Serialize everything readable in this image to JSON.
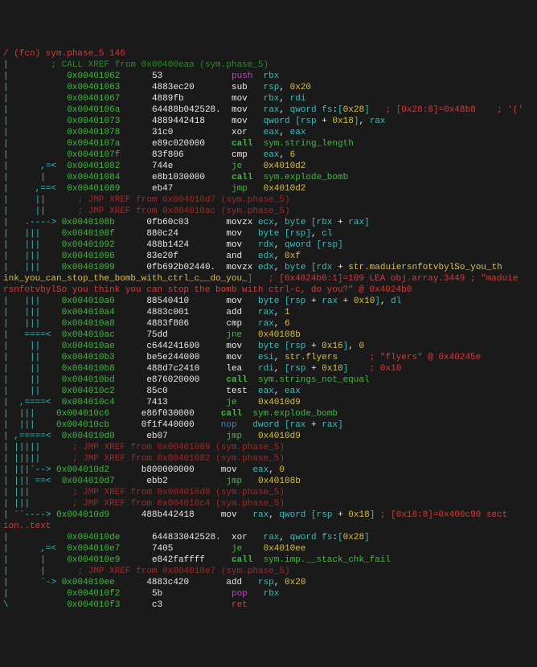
{
  "header": {
    "fcn": "/ (fcn) sym.phase_5 146",
    "xref": "        ; CALL XREF from 0x00400eaa (sym.phase_5)"
  },
  "rows": [
    {
      "p": "|           ",
      "a": "0x00401062",
      "b": "53            ",
      "o": "push",
      "r": "rbx"
    },
    {
      "p": "|           ",
      "a": "0x00401063",
      "b": "4883ec20      ",
      "o": "sub",
      "r": "rsp, 0x20"
    },
    {
      "p": "|           ",
      "a": "0x00401067",
      "b": "4889fb        ",
      "o": "mov",
      "r": "rbx, rdi"
    },
    {
      "p": "|           ",
      "a": "0x0040106a",
      "b": "64488b042528. ",
      "o": "mov",
      "r": "rax, qword fs:[0x28]",
      "c": "   ; [0x28:8]=0x48b8    ; '('"
    },
    {
      "p": "|           ",
      "a": "0x00401073",
      "b": "4889442418    ",
      "o": "mov",
      "r": "qword [rsp + 0x18], rax"
    },
    {
      "p": "|           ",
      "a": "0x00401078",
      "b": "31c0          ",
      "o": "xor",
      "r": "eax, eax"
    },
    {
      "p": "|           ",
      "a": "0x0040107a",
      "b": "e89c020000    ",
      "o": "call",
      "r": "sym.string_length",
      "call": true
    },
    {
      "p": "|           ",
      "a": "0x0040107f",
      "b": "83f806        ",
      "o": "cmp",
      "r": "eax, 6"
    },
    {
      "p": "|      ,=<  ",
      "a": "0x00401082",
      "b": "744e          ",
      "o": "je",
      "r": "0x4010d2"
    },
    {
      "p": "|      |    ",
      "a": "0x00401084",
      "b": "e8b1030000    ",
      "o": "call",
      "r": "sym.explode_bomb",
      "call": true
    },
    {
      "p": "|     ,==<  ",
      "a": "0x00401089",
      "b": "eb47          ",
      "o": "jmp",
      "r": "0x4010d2"
    },
    {
      "p": "|     ||    ",
      "x": "  ; JMP XREF from 0x004010d7 (sym.phase_5)"
    },
    {
      "p": "|     ||    ",
      "x": "  ; JMP XREF from 0x004010ac (sym.phase_5)"
    },
    {
      "p": "|   .----> ",
      "a": "0x0040108b",
      "b": "0fb60c03      ",
      "o": "movzx",
      "r": "ecx, byte [rbx + rax]"
    },
    {
      "p": "|   |||    ",
      "a": "0x0040108f",
      "b": "880c24        ",
      "o": "mov",
      "r": "byte [rsp], cl"
    },
    {
      "p": "|   |||    ",
      "a": "0x00401092",
      "b": "488b1424      ",
      "o": "mov",
      "r": "rdx, qword [rsp]"
    },
    {
      "p": "|   |||    ",
      "a": "0x00401096",
      "b": "83e20f        ",
      "o": "and",
      "r": "edx, 0xf"
    },
    {
      "p": "|   |||    ",
      "a": "0x00401099",
      "b": "0fb692b02440. ",
      "o": "movzx",
      "r": "edx, byte [rdx + str.maduiersnfotvbylSo_you_th",
      "nowrap": true
    },
    {
      "raw": true,
      "p": "",
      "text": "ink_you_can_stop_the_bomb_with_ctrl_c__do_you_",
      "comment": "]   ; [0x4024b0:1]=109 LEA obj.array.3449 ; \"maduie"
    },
    {
      "raw": true,
      "p": "",
      "text2": "rsnfotvbylSo you think you can stop the bomb with ctrl-c, do you?\" @ 0x4024b0"
    },
    {
      "p": "|   |||    ",
      "a": "0x004010a0",
      "b": "88540410      ",
      "o": "mov",
      "r": "byte [rsp + rax + 0x10], dl"
    },
    {
      "p": "|   |||    ",
      "a": "0x004010a4",
      "b": "4883c001      ",
      "o": "add",
      "r": "rax, 1"
    },
    {
      "p": "|   |||    ",
      "a": "0x004010a8",
      "b": "4883f806      ",
      "o": "cmp",
      "r": "rax, 6"
    },
    {
      "p": "|   ====<  ",
      "a": "0x004010ac",
      "b": "75dd          ",
      "o": "jne",
      "r": "0x40108b"
    },
    {
      "p": "|    ||    ",
      "a": "0x004010ae",
      "b": "c644241600    ",
      "o": "mov",
      "r": "byte [rsp + 0x16], 0"
    },
    {
      "p": "|    ||    ",
      "a": "0x004010b3",
      "b": "be5e244000    ",
      "o": "mov",
      "r": "esi, str.flyers",
      "c": "      ; \"flyers\" @ 0x40245e"
    },
    {
      "p": "|    ||    ",
      "a": "0x004010b8",
      "b": "488d7c2410    ",
      "o": "lea",
      "r": "rdi, [rsp + 0x10]",
      "c": "    ; 0x10"
    },
    {
      "p": "|    ||    ",
      "a": "0x004010bd",
      "b": "e876020000    ",
      "o": "call",
      "r": "sym.strings_not_equal",
      "call": true
    },
    {
      "p": "|    ||    ",
      "a": "0x004010c2",
      "b": "85c0          ",
      "o": "test",
      "r": "eax, eax"
    },
    {
      "p": "|  ,====<  ",
      "a": "0x004010c4",
      "b": "7413          ",
      "o": "je",
      "r": "0x4010d9"
    },
    {
      "p": "|  |||    ",
      "a": "0x004010c6",
      "b": "e86f030000    ",
      "o": "call",
      "r": "sym.explode_bomb",
      "call": true
    },
    {
      "p": "|  |||    ",
      "a": "0x004010cb",
      "b": "0f1f440000    ",
      "o": "nop",
      "r": "dword [rax + rax]"
    },
    {
      "p": "| ,=====<  ",
      "a": "0x004010d0",
      "b": "eb07          ",
      "o": "jmp",
      "r": "0x4010d9"
    },
    {
      "p": "| |||||    ",
      "x": "  ; JMP XREF from 0x00401089 (sym.phase_5)"
    },
    {
      "p": "| |||||    ",
      "x": "  ; JMP XREF from 0x00401082 (sym.phase_5)"
    },
    {
      "p": "| |||`--> ",
      "a": "0x004010d2",
      "b": "b800000000    ",
      "o": "mov",
      "r": "eax, 0"
    },
    {
      "p": "| ||| ==<  ",
      "a": "0x004010d7",
      "b": "ebb2          ",
      "o": "jmp",
      "r": "0x40108b"
    },
    {
      "p": "| |||      ",
      "x": "  ; JMP XREF from 0x004010d0 (sym.phase_5)"
    },
    {
      "p": "| |||      ",
      "x": "  ; JMP XREF from 0x004010c4 (sym.phase_5)"
    },
    {
      "p": "| ``----> ",
      "a": "0x004010d9",
      "b": "488b442418    ",
      "o": "mov",
      "r": "rax, qword [rsp + 0x18]",
      "c": " ; [0x18:8]=0x400c90 sect",
      "nowrap": true
    },
    {
      "raw": true,
      "p": "",
      "text2": "ion..text"
    },
    {
      "p": "|           ",
      "a": "0x004010de",
      "b": "644833042528. ",
      "o": "xor",
      "r": "rax, qword fs:[0x28]"
    },
    {
      "p": "|      ,=<  ",
      "a": "0x004010e7",
      "b": "7405          ",
      "o": "je",
      "r": "0x4010ee"
    },
    {
      "p": "|      |    ",
      "a": "0x004010e9",
      "b": "e842faffff    ",
      "o": "call",
      "r": "sym.imp.__stack_chk_fail",
      "call": true
    },
    {
      "p": "|      |    ",
      "x": "  ; JMP XREF from 0x004010e7 (sym.phase_5)"
    },
    {
      "p": "|      `-> ",
      "a": "0x004010ee",
      "b": "4883c420      ",
      "o": "add",
      "r": "rsp, 0x20"
    },
    {
      "p": "|           ",
      "a": "0x004010f2",
      "b": "5b            ",
      "o": "pop",
      "r": "rbx"
    },
    {
      "p": "\\           ",
      "a": "0x004010f3",
      "b": "c3            ",
      "o": "ret",
      "r": ""
    }
  ]
}
